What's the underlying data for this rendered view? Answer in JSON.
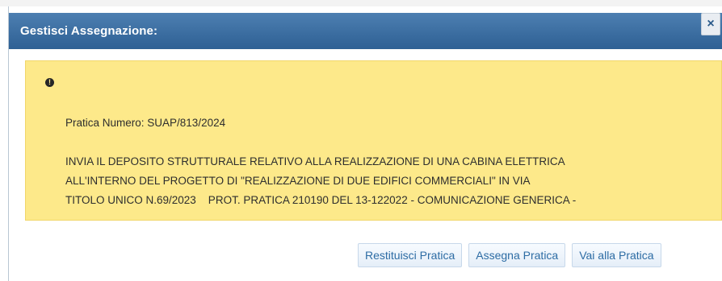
{
  "dialog": {
    "title": "Gestisci Assegnazione:",
    "close_label": "×"
  },
  "notice": {
    "icon": "exclamation-circle-icon",
    "practice_number": "Pratica Numero: SUAP/813/2024",
    "description_lines": [
      "INVIA IL DEPOSITO STRUTTURALE RELATIVO ALLA REALIZZAZIONE DI UNA CABINA ELETTRICA",
      "ALL'INTERNO DEL PROGETTO DI \"REALIZZAZIONE DI DUE EDIFICI COMMERCIALI\" IN VIA",
      "TITOLO UNICO N.69/2023    PROT. PRATICA 210190 DEL 13-122022 - COMUNICAZIONE GENERICA -"
    ]
  },
  "buttons": {
    "return_label": "Restituisci Pratica",
    "assign_label": "Assegna Pratica",
    "go_label": "Vai alla Pratica"
  },
  "colors": {
    "titlebar": "#2e6094",
    "notice_background": "#fde98a",
    "button_text": "#2d6ca4"
  }
}
